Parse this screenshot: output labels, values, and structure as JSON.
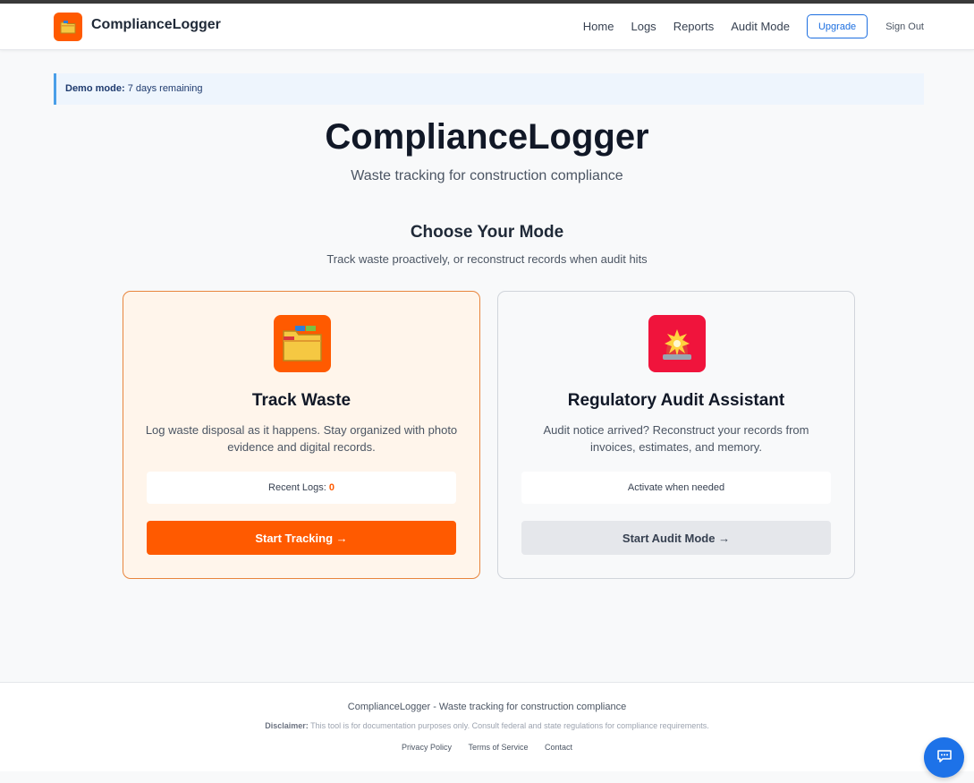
{
  "header": {
    "brand": "ComplianceLogger",
    "nav": [
      "Home",
      "Logs",
      "Reports",
      "Audit Mode"
    ],
    "upgrade_label": "Upgrade",
    "signout_label": "Sign Out"
  },
  "banner": {
    "label": "Demo mode:",
    "text": "7 days remaining"
  },
  "hero": {
    "title": "ComplianceLogger",
    "subtitle": "Waste tracking for construction compliance"
  },
  "mode": {
    "title": "Choose Your Mode",
    "subtitle": "Track waste proactively, or reconstruct records when audit hits"
  },
  "cards": {
    "track": {
      "icon": "folder-icon",
      "title": "Track Waste",
      "description": "Log waste disposal as it happens. Stay organized with photo evidence and digital records.",
      "stat_label": "Recent Logs:",
      "stat_value": "0",
      "button_label": "Start Tracking",
      "arrow": "→"
    },
    "audit": {
      "icon": "siren-icon",
      "title": "Regulatory Audit Assistant",
      "description": "Audit notice arrived? Reconstruct your records from invoices, estimates, and memory.",
      "stat_label": "Activate when needed",
      "button_label": "Start Audit Mode",
      "arrow": "→"
    }
  },
  "footer": {
    "main": "ComplianceLogger - Waste tracking for construction compliance",
    "disclaimer_label": "Disclaimer:",
    "disclaimer_text": "This tool is for documentation purposes only. Consult federal and state regulations for compliance requirements.",
    "links": [
      "Privacy Policy",
      "Terms of Service",
      "Contact"
    ]
  },
  "colors": {
    "accent": "#ff5a00",
    "primary_blue": "#1d72e8",
    "alert_red": "#f0143c"
  }
}
